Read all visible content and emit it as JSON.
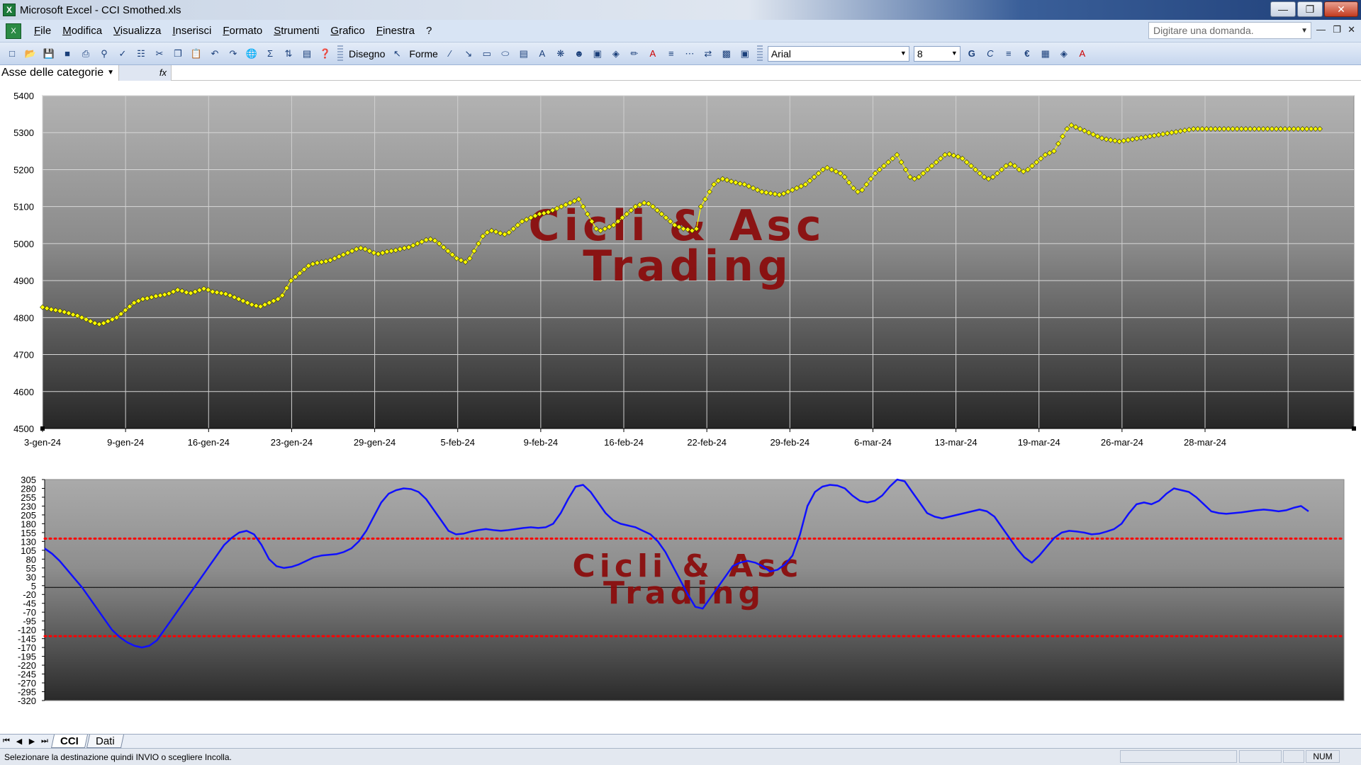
{
  "window": {
    "title": "Microsoft Excel - CCI Smothed.xls",
    "app_icon": "excel-icon"
  },
  "menu": {
    "items": [
      "File",
      "Modifica",
      "Visualizza",
      "Inserisci",
      "Formato",
      "Strumenti",
      "Grafico",
      "Finestra",
      "?"
    ],
    "ask_placeholder": "Digitare una domanda."
  },
  "toolbar": {
    "draw_label": "Disegno",
    "shapes_label": "Forme",
    "font_name": "Arial",
    "font_size": "8",
    "bold_label": "G",
    "italic_label": "C",
    "currency_label": "€"
  },
  "chart_object_selector": {
    "value": "Asse delle categorie"
  },
  "watermark": {
    "line1": "Cicli & Asc",
    "line2": "Trading",
    "color": "#8b0a0a"
  },
  "chart_data": [
    {
      "type": "line",
      "title": "",
      "series": [
        {
          "name": "",
          "color": "#ffff00",
          "marker": "diamond",
          "values": [
            4828,
            4825,
            4822,
            4820,
            4818,
            4815,
            4812,
            4808,
            4805,
            4800,
            4795,
            4790,
            4785,
            4782,
            4785,
            4790,
            4795,
            4800,
            4810,
            4820,
            4830,
            4840,
            4845,
            4850,
            4852,
            4855,
            4858,
            4860,
            4862,
            4865,
            4870,
            4875,
            4872,
            4868,
            4866,
            4870,
            4874,
            4878,
            4875,
            4870,
            4868,
            4866,
            4864,
            4860,
            4855,
            4850,
            4845,
            4840,
            4835,
            4832,
            4830,
            4835,
            4840,
            4845,
            4850,
            4860,
            4880,
            4900,
            4910,
            4920,
            4930,
            4940,
            4945,
            4948,
            4950,
            4952,
            4955,
            4960,
            4965,
            4970,
            4975,
            4980,
            4985,
            4988,
            4985,
            4980,
            4975,
            4972,
            4975,
            4978,
            4980,
            4982,
            4985,
            4988,
            4990,
            4995,
            5000,
            5005,
            5010,
            5012,
            5008,
            5000,
            4990,
            4980,
            4970,
            4960,
            4955,
            4950,
            4960,
            4980,
            5000,
            5020,
            5030,
            5035,
            5032,
            5028,
            5025,
            5030,
            5040,
            5050,
            5060,
            5065,
            5070,
            5075,
            5080,
            5082,
            5085,
            5090,
            5095,
            5100,
            5105,
            5110,
            5115,
            5120,
            5100,
            5080,
            5060,
            5040,
            5035,
            5040,
            5045,
            5050,
            5060,
            5070,
            5080,
            5090,
            5100,
            5105,
            5110,
            5108,
            5100,
            5090,
            5080,
            5070,
            5060,
            5050,
            5045,
            5040,
            5038,
            5035,
            5040,
            5100,
            5120,
            5140,
            5160,
            5170,
            5175,
            5172,
            5168,
            5165,
            5162,
            5160,
            5155,
            5150,
            5145,
            5140,
            5138,
            5136,
            5134,
            5132,
            5135,
            5140,
            5145,
            5150,
            5155,
            5160,
            5170,
            5180,
            5190,
            5200,
            5205,
            5200,
            5195,
            5190,
            5180,
            5165,
            5150,
            5140,
            5145,
            5160,
            5175,
            5190,
            5200,
            5210,
            5220,
            5230,
            5240,
            5220,
            5200,
            5180,
            5175,
            5180,
            5190,
            5200,
            5210,
            5220,
            5230,
            5240,
            5242,
            5238,
            5235,
            5230,
            5220,
            5210,
            5200,
            5190,
            5180,
            5175,
            5180,
            5190,
            5200,
            5210,
            5215,
            5210,
            5200,
            5195,
            5200,
            5210,
            5220,
            5230,
            5240,
            5245,
            5250,
            5270,
            5290,
            5310,
            5320,
            5315,
            5310,
            5305,
            5300,
            5295,
            5290,
            5285,
            5282,
            5280,
            5278,
            5276,
            5278,
            5280,
            5282,
            5284,
            5286,
            5288,
            5290,
            5292,
            5294,
            5296,
            5298,
            5300,
            5302,
            5304,
            5306,
            5308,
            5310,
            5310,
            5310,
            5310,
            5310,
            5310,
            5310,
            5310,
            5310,
            5310,
            5310,
            5310,
            5310,
            5310,
            5310,
            5310,
            5310,
            5310,
            5310,
            5310,
            5310,
            5310,
            5310,
            5310,
            5310,
            5310,
            5310,
            5310,
            5310,
            5310
          ]
        }
      ],
      "ylim": [
        4500,
        5400
      ],
      "yticks": [
        4500,
        4600,
        4700,
        4800,
        4900,
        5000,
        5100,
        5200,
        5300,
        5400
      ],
      "x_ticks": [
        "3-gen-24",
        "9-gen-24",
        "16-gen-24",
        "23-gen-24",
        "29-gen-24",
        "5-feb-24",
        "9-feb-24",
        "16-feb-24",
        "22-feb-24",
        "29-feb-24",
        "6-mar-24",
        "13-mar-24",
        "19-mar-24",
        "26-mar-24",
        "28-mar-24"
      ],
      "grid": true,
      "xlabel": "",
      "ylabel": ""
    },
    {
      "type": "line",
      "title": "",
      "series": [
        {
          "name": "",
          "color": "#1010ff",
          "values": [
            110,
            95,
            75,
            50,
            25,
            0,
            -30,
            -60,
            -90,
            -120,
            -140,
            -155,
            -165,
            -170,
            -165,
            -150,
            -120,
            -90,
            -60,
            -30,
            0,
            30,
            60,
            90,
            120,
            140,
            155,
            160,
            150,
            120,
            80,
            60,
            55,
            58,
            65,
            75,
            85,
            90,
            92,
            94,
            100,
            110,
            130,
            160,
            200,
            240,
            265,
            275,
            280,
            278,
            270,
            250,
            220,
            190,
            160,
            150,
            152,
            158,
            162,
            165,
            162,
            160,
            162,
            165,
            168,
            170,
            168,
            170,
            180,
            210,
            250,
            285,
            290,
            270,
            240,
            210,
            190,
            180,
            175,
            170,
            160,
            150,
            130,
            100,
            60,
            20,
            -20,
            -55,
            -60,
            -30,
            0,
            30,
            60,
            70,
            75,
            70,
            60,
            45,
            50,
            65,
            90,
            150,
            230,
            270,
            285,
            290,
            288,
            280,
            260,
            245,
            240,
            245,
            260,
            285,
            305,
            300,
            270,
            240,
            210,
            200,
            195,
            200,
            205,
            210,
            215,
            220,
            215,
            200,
            170,
            140,
            110,
            85,
            70,
            90,
            115,
            140,
            155,
            160,
            158,
            155,
            150,
            152,
            158,
            165,
            180,
            210,
            235,
            240,
            235,
            245,
            265,
            280,
            275,
            270,
            255,
            235,
            215,
            210,
            208,
            210,
            212,
            215,
            218,
            220,
            218,
            215,
            218,
            225,
            230,
            215
          ]
        }
      ],
      "ylim": [
        -320,
        305
      ],
      "yticks": [
        305,
        280,
        255,
        230,
        205,
        180,
        155,
        130,
        105,
        80,
        55,
        30,
        5,
        -20,
        -45,
        -70,
        -95,
        -120,
        -145,
        -170,
        -195,
        -220,
        -245,
        -270,
        -295,
        -320
      ],
      "ref_lines": [
        {
          "value": 138,
          "color": "#ff0000",
          "style": "dotted"
        },
        {
          "value": -138,
          "color": "#ff0000",
          "style": "dotted"
        },
        {
          "value": 0,
          "color": "#000000",
          "style": "solid"
        }
      ],
      "grid": false,
      "xlabel": "",
      "ylabel": ""
    }
  ],
  "tabs": [
    {
      "label": "CCI",
      "active": true
    },
    {
      "label": "Dati",
      "active": false
    }
  ],
  "status": {
    "message": "Selezionare la destinazione quindi INVIO o scegliere Incolla.",
    "num_indicator": "NUM"
  }
}
